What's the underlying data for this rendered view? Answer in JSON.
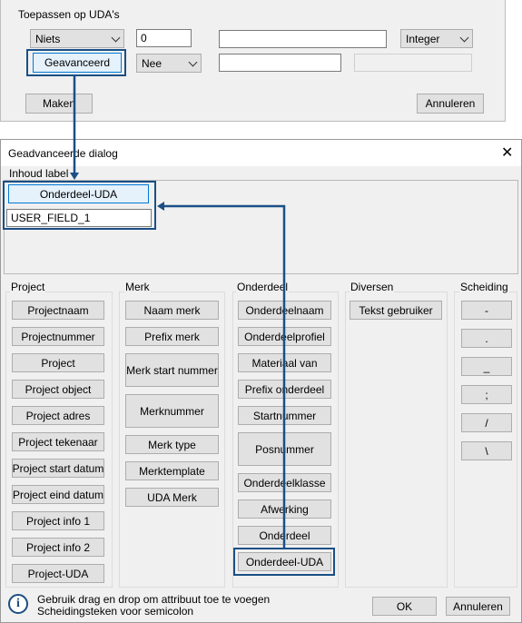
{
  "top_panel": {
    "group_label": "Toepassen op UDA's",
    "combo_niets": "Niets",
    "value_input": "0",
    "text_input_1": "",
    "combo_integer": "Integer",
    "advanced_button": "Geavanceerd",
    "combo_nee": "Nee",
    "text_input_2": "",
    "text_input_3": "",
    "make_button": "Maken",
    "cancel_button": "Annuleren"
  },
  "dialog": {
    "title": "Geadvanceerde dialog",
    "close_glyph": "✕",
    "content_label": "Inhoud label",
    "content_button": "Onderdeel-UDA",
    "content_input": "USER_FIELD_1",
    "groups": {
      "project": {
        "label": "Project",
        "items": [
          "Projectnaam",
          "Projectnummer",
          "Project",
          "Project object",
          "Project adres",
          "Project tekenaar",
          "Project start datum",
          "Project eind datum",
          "Project info 1",
          "Project info 2",
          "Project-UDA"
        ]
      },
      "merk": {
        "label": "Merk",
        "items": [
          "Naam merk",
          "Prefix merk",
          "Merk start nummer",
          "Merknummer",
          "Merk type",
          "Merktemplate",
          "UDA Merk"
        ]
      },
      "onderdeel": {
        "label": "Onderdeel",
        "items": [
          "Onderdeelnaam",
          "Onderdeelprofiel",
          "Materiaal van",
          "Prefix onderdeel",
          "Startnummer",
          "Posnummer",
          "Onderdeelklasse",
          "Afwerking",
          "Onderdeel",
          "Onderdeel-UDA"
        ]
      },
      "diversen": {
        "label": "Diversen",
        "items": [
          "Tekst gebruiker"
        ]
      },
      "scheiding": {
        "label": "Scheiding",
        "items": [
          "-",
          ".",
          "_",
          ";",
          "/",
          "\\"
        ]
      }
    },
    "info_icon_glyph": "i",
    "info_line_1": "Gebruik drag en drop om attribuut toe te voegen",
    "info_line_2": "Scheidingsteken voor semicolon",
    "ok_button": "OK",
    "cancel_button": "Annuleren"
  },
  "colors": {
    "highlight": "#1a4f86",
    "dialog_bg": "#f0f0f0",
    "button_bg": "#e1e1e1",
    "info_icon": "#1c4e80"
  }
}
